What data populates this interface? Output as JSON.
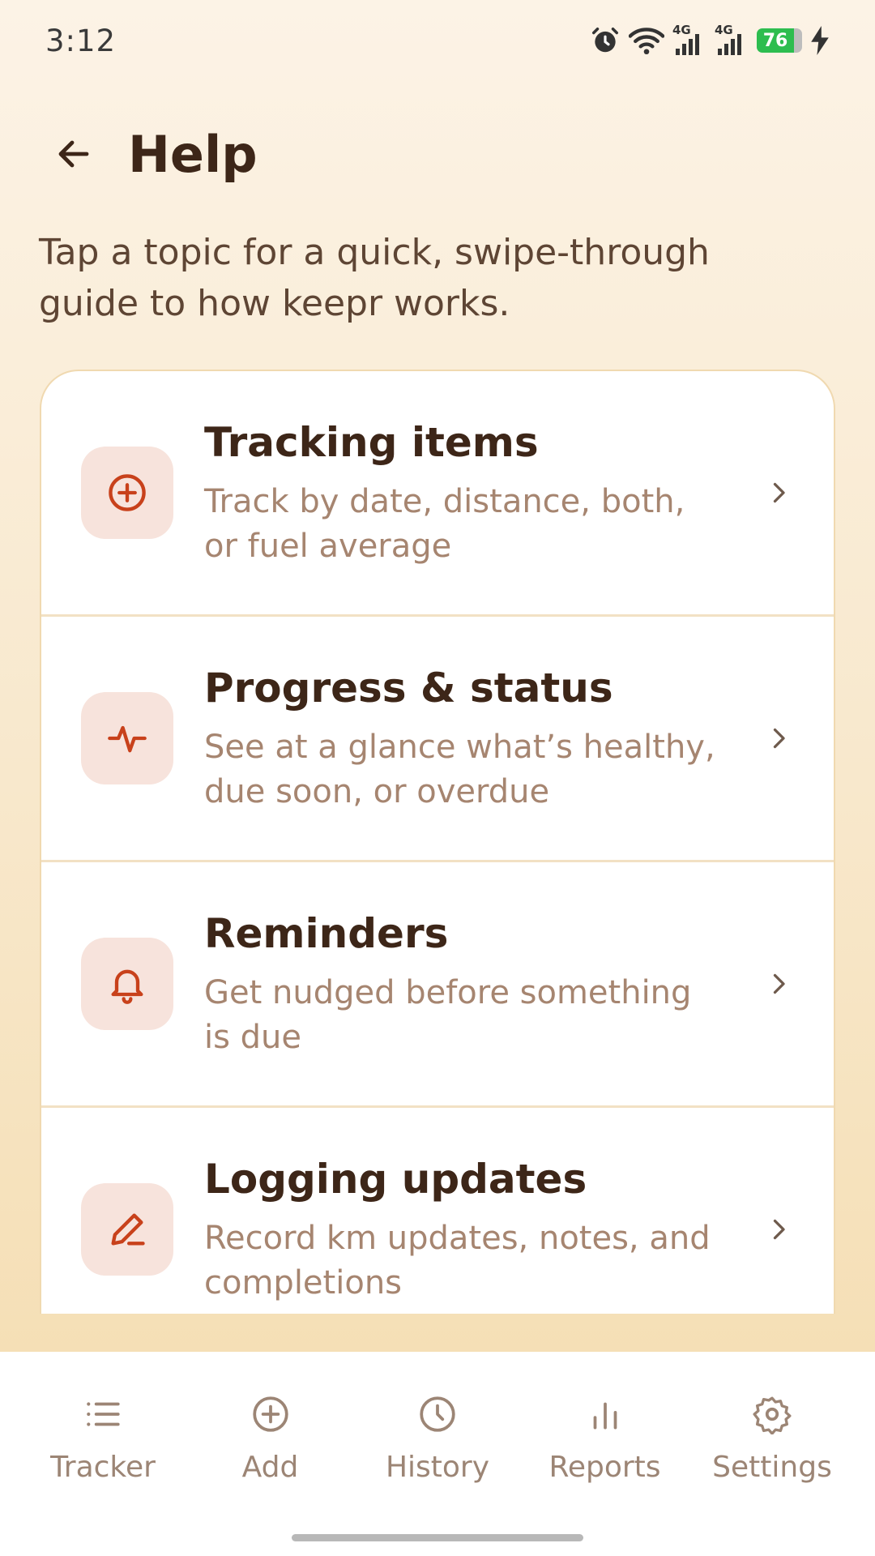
{
  "status_bar": {
    "time": "3:12",
    "network_tag_1": "4G",
    "network_tag_2": "4G",
    "battery_level": "76"
  },
  "header": {
    "title": "Help"
  },
  "intro_text": "Tap a topic for a quick, swipe-through guide to how keepr works.",
  "topics": [
    {
      "title": "Tracking items",
      "description": "Track by date, distance, both, or fuel average",
      "icon": "plus-circle-icon"
    },
    {
      "title": "Progress & status",
      "description": "See at a glance what’s healthy, due soon, or overdue",
      "icon": "activity-icon"
    },
    {
      "title": "Reminders",
      "description": "Get nudged before something is due",
      "icon": "bell-icon"
    },
    {
      "title": "Logging updates",
      "description": "Record km updates, notes, and completions",
      "icon": "pencil-icon"
    }
  ],
  "bottom_nav": [
    {
      "label": "Tracker",
      "icon": "list-icon"
    },
    {
      "label": "Add",
      "icon": "plus-circle-icon"
    },
    {
      "label": "History",
      "icon": "clock-icon"
    },
    {
      "label": "Reports",
      "icon": "bar-chart-icon"
    },
    {
      "label": "Settings",
      "icon": "gear-icon"
    }
  ],
  "colors": {
    "accent": "#c8411b",
    "icon_bg": "#f7e3dc",
    "title_text": "#3d2618",
    "desc_text": "#a68570",
    "nav_text": "#9c8575",
    "battery": "#2dbd4f"
  }
}
